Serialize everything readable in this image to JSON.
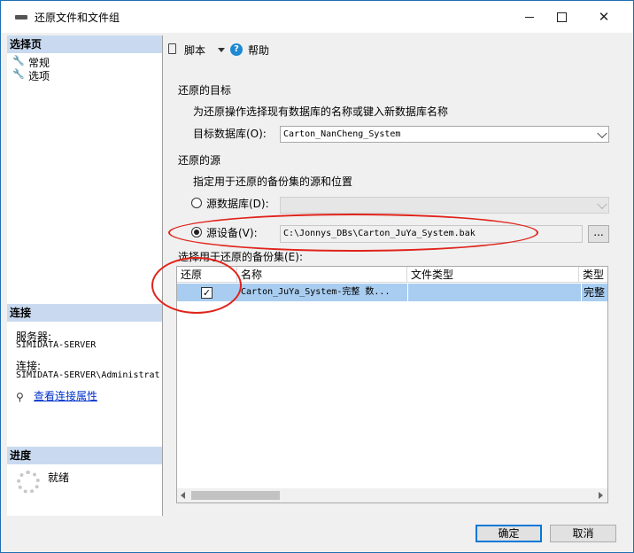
{
  "window": {
    "title": "还原文件和文件组"
  },
  "left": {
    "select_page_heading": "选择页",
    "pages": [
      {
        "label": "常规"
      },
      {
        "label": "选项"
      }
    ],
    "connection_heading": "连接",
    "server_label": "服务器:",
    "server_value": "SIMIDATA-SERVER",
    "connection_label": "连接:",
    "connection_value": "SIMIDATA-SERVER\\Administrat",
    "view_connection_link": "查看连接属性",
    "progress_heading": "进度",
    "progress_status": "就绪"
  },
  "toolbar": {
    "script_label": "脚本",
    "help_label": "帮助"
  },
  "target": {
    "section_title": "还原的目标",
    "description": "为还原操作选择现有数据库的名称或键入新数据库名称",
    "db_label": "目标数据库(O):",
    "db_value": "Carton_NanCheng_System"
  },
  "source": {
    "section_title": "还原的源",
    "description": "指定用于还原的备份集的源和位置",
    "source_db_label": "源数据库(D):",
    "source_device_label": "源设备(V):",
    "source_device_value": "C:\\Jonnys_DBs\\Carton_JuYa_System.bak",
    "browse_label": "..."
  },
  "backup_sets": {
    "label": "选择用于还原的备份集(E):",
    "columns": [
      "还原",
      "名称",
      "文件类型",
      "类型"
    ],
    "rows": [
      {
        "restore": true,
        "name": "Carton_JuYa_System-完整 数...",
        "file_type": "",
        "type": "完整"
      }
    ]
  },
  "footer": {
    "ok_label": "确定",
    "cancel_label": "取消"
  },
  "colors": {
    "accent": "#0078d7",
    "annotation_red": "#e0231b",
    "section_header": "#c9daf0",
    "row_selected": "#a9cdf0"
  }
}
